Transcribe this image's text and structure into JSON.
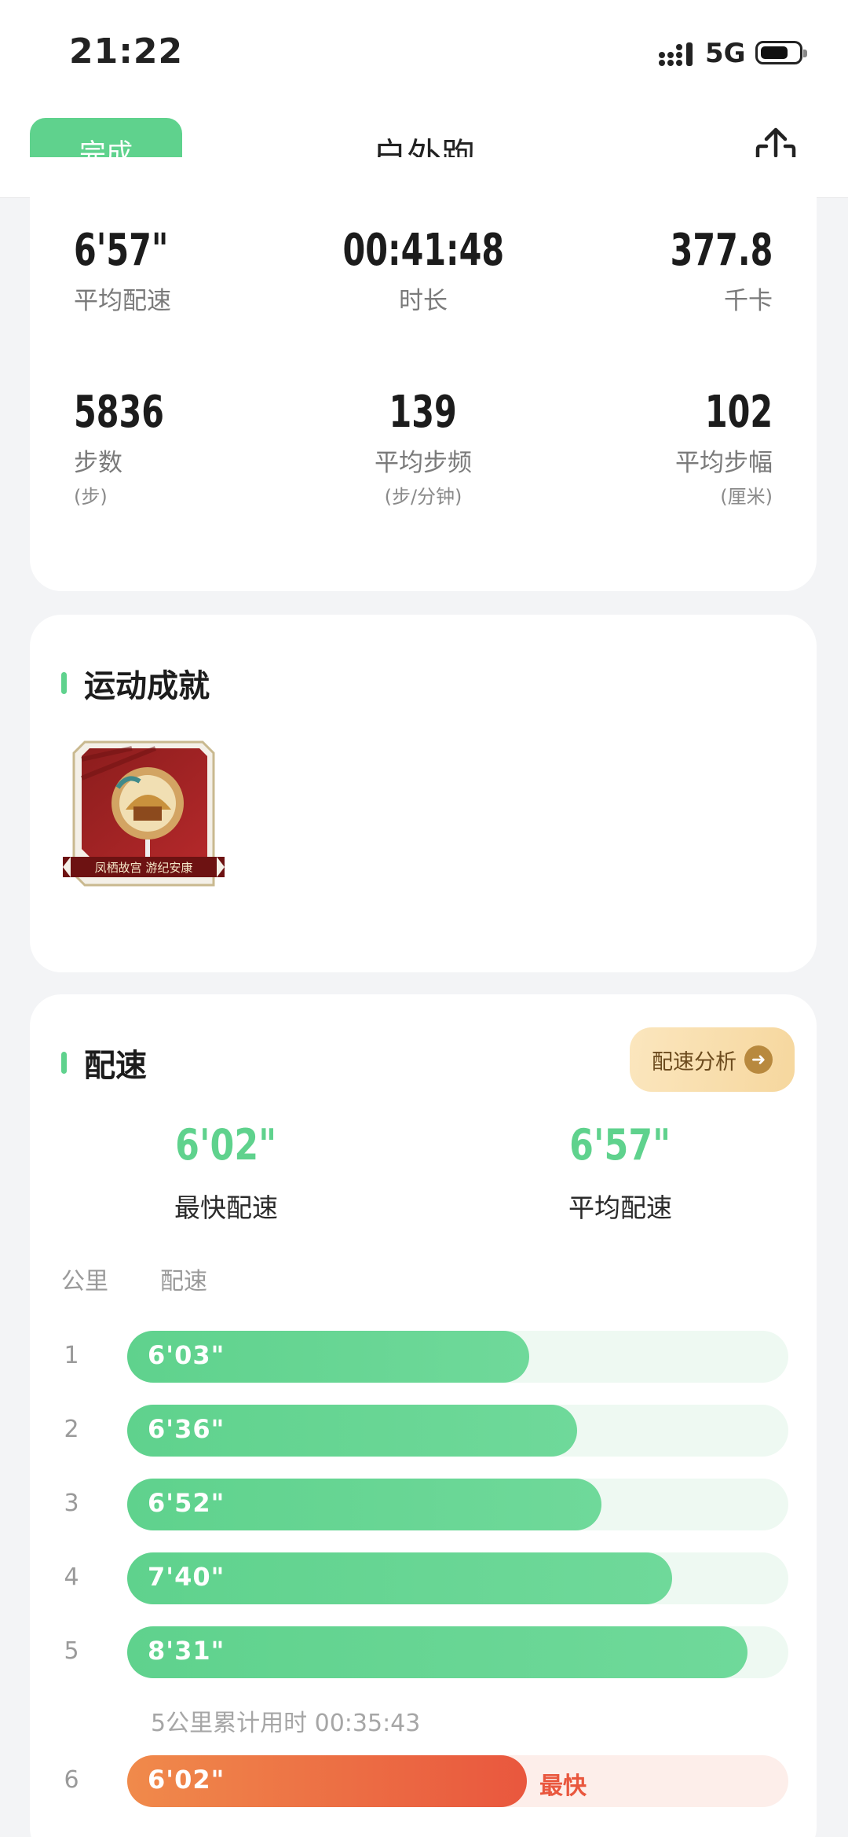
{
  "status_bar": {
    "time": "21:22",
    "network": "5G"
  },
  "nav": {
    "done_label": "完成",
    "title": "户外跑"
  },
  "summary": {
    "avg_pace": {
      "value": "6'57\"",
      "label": "平均配速"
    },
    "duration": {
      "value": "00:41:48",
      "label": "时长"
    },
    "calories": {
      "value": "377.8",
      "label": "千卡"
    },
    "steps": {
      "value": "5836",
      "label": "步数",
      "unit": "(步)"
    },
    "cadence": {
      "value": "139",
      "label": "平均步频",
      "unit": "(步/分钟)"
    },
    "stride": {
      "value": "102",
      "label": "平均步幅",
      "unit": "(厘米)"
    }
  },
  "achievements": {
    "title": "运动成就",
    "medal_text": "凤栖故宫 游纪安康"
  },
  "pace": {
    "title": "配速",
    "analysis_label": "配速分析",
    "fastest": {
      "value": "6'02\"",
      "label": "最快配速"
    },
    "average": {
      "value": "6'57\"",
      "label": "平均配速"
    },
    "col_km": "公里",
    "col_pace": "配速",
    "splits": [
      {
        "km": "1",
        "pace": "6'03\"",
        "fraction": 0.608
      },
      {
        "km": "2",
        "pace": "6'36\"",
        "fraction": 0.681
      },
      {
        "km": "3",
        "pace": "6'52\"",
        "fraction": 0.717
      },
      {
        "km": "4",
        "pace": "7'40\"",
        "fraction": 0.824
      },
      {
        "km": "5",
        "pace": "8'31\"",
        "fraction": 0.938
      },
      {
        "km": "6",
        "pace": "6'02\"",
        "fraction": 0.604,
        "tag": "最快"
      }
    ],
    "cumulative_note": "5公里累计用时 00:35:43"
  },
  "colors": {
    "accent": "#5fd28d",
    "fastest": "#e9573e"
  }
}
